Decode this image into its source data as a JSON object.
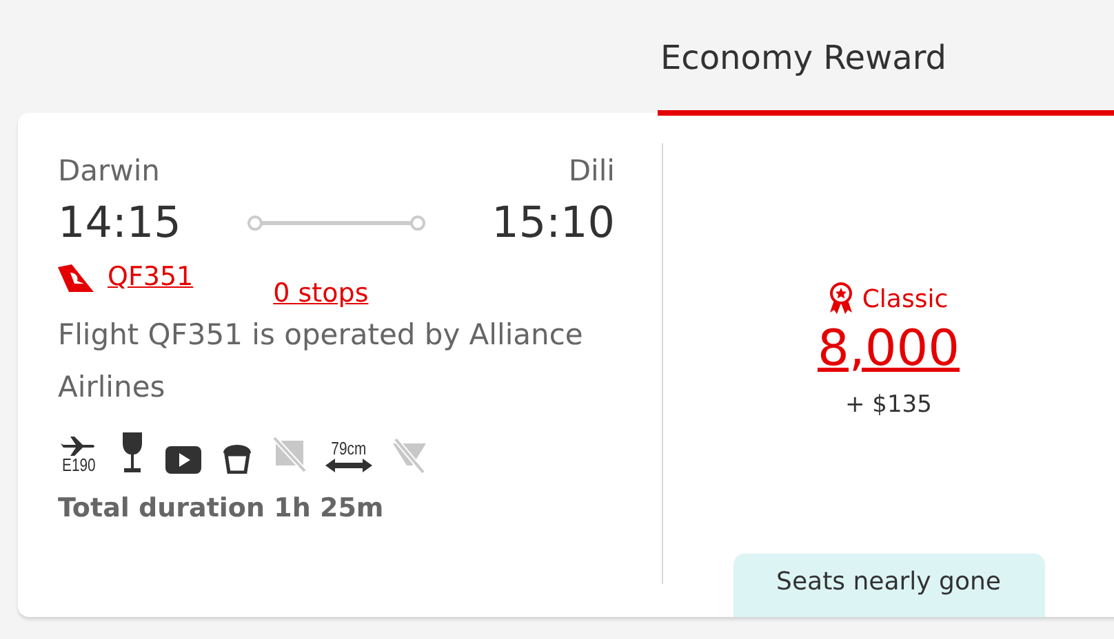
{
  "fare_tab": {
    "label": "Economy Reward",
    "selected": true
  },
  "flight": {
    "origin": "Darwin",
    "destination": "Dili",
    "depart": "14:15",
    "arrive": "15:10",
    "flight_number": "QF351",
    "stops": "0 stops",
    "operator_note": "Flight QF351 is operated by Alliance Airlines",
    "duration": "Total duration 1h 25m"
  },
  "amenities": [
    {
      "kind": "aircraft",
      "label": "E190",
      "available": true
    },
    {
      "kind": "wine",
      "available": true
    },
    {
      "kind": "video",
      "available": true
    },
    {
      "kind": "meal",
      "available": true
    },
    {
      "kind": "wifi",
      "available": false
    },
    {
      "kind": "legroom",
      "label": "79cm",
      "available": true
    },
    {
      "kind": "power",
      "available": false
    }
  ],
  "fare": {
    "type": "Classic",
    "points": "8,000",
    "taxes": "+ $135",
    "badge": "Seats nearly gone"
  }
}
